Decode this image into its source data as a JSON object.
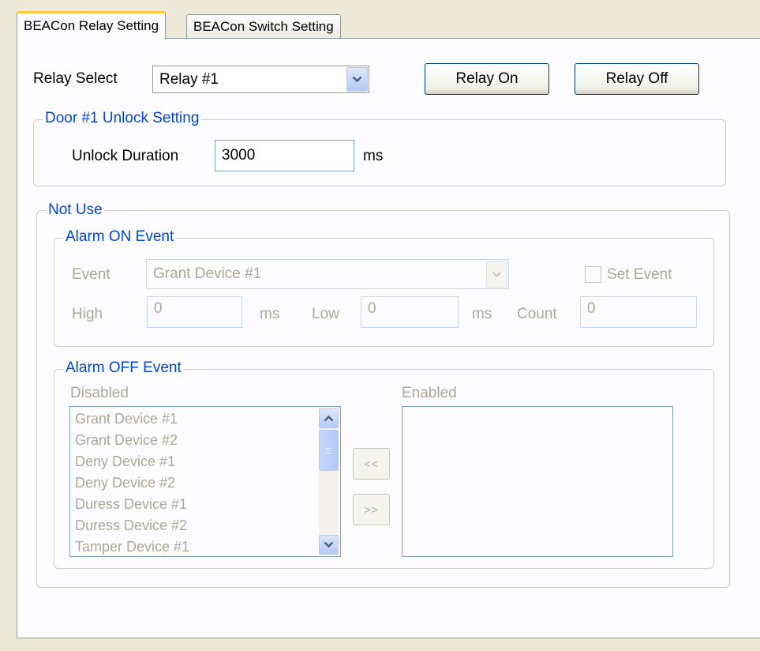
{
  "tabs": [
    {
      "label": "BEACon Relay Setting",
      "active": true
    },
    {
      "label": "BEACon Switch Setting",
      "active": false
    }
  ],
  "relay": {
    "select_label": "Relay Select",
    "select_value": "Relay #1",
    "on_button": "Relay On",
    "off_button": "Relay Off"
  },
  "door": {
    "group_title": "Door #1 Unlock Setting",
    "duration_label": "Unlock Duration",
    "duration_value": "3000",
    "unit": "ms"
  },
  "not_use": {
    "group_title": "Not Use",
    "alarm_on": {
      "group_title": "Alarm ON Event",
      "event_label": "Event",
      "event_value": "Grant Device #1",
      "set_event_label": "Set Event",
      "set_event_checked": false,
      "high_label": "High",
      "high_value": "0",
      "high_unit": "ms",
      "low_label": "Low",
      "low_value": "0",
      "low_unit": "ms",
      "count_label": "Count",
      "count_value": "0"
    },
    "alarm_off": {
      "group_title": "Alarm OFF Event",
      "disabled_label": "Disabled",
      "enabled_label": "Enabled",
      "disabled_items": [
        "Grant Device #1",
        "Grant Device #2",
        "Deny Device #1",
        "Deny Device #2",
        "Duress Device #1",
        "Duress Device #2",
        "Tamper Device #1"
      ],
      "enabled_items": [],
      "move_left_label": "<<",
      "move_right_label": ">>"
    }
  },
  "colors": {
    "group_title": "#0046d5",
    "disabled_text": "#aca899",
    "tab_highlight": "#ffc83c"
  }
}
